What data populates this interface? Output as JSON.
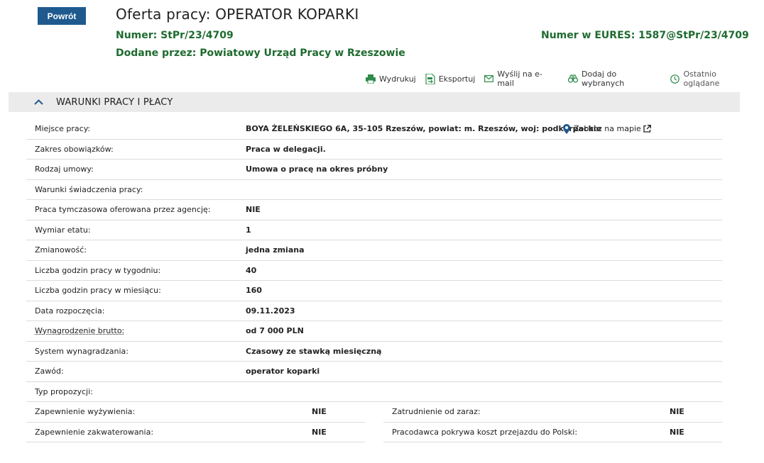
{
  "header": {
    "back_label": "Powrót",
    "title": "Oferta pracy: OPERATOR KOPARKI",
    "numer_label": "Numer: StPr/23/4709",
    "eures_label": "Numer w EURES: 1587@StPr/23/4709",
    "dodane_label": "Dodane przez: ",
    "dodane_value": "Powiatowy Urząd Pracy w Rzeszowie"
  },
  "actions": [
    {
      "label": "Wydrukuj",
      "icon": "printer-icon"
    },
    {
      "label": "Eksportuj",
      "icon": "export-file-icon"
    },
    {
      "label": "Wyślij na e-mail",
      "icon": "envelope-icon"
    },
    {
      "label": "Dodaj do wybranych",
      "icon": "binoculars-icon"
    },
    {
      "label": "Ostatnio oglądane",
      "icon": "clock-icon"
    }
  ],
  "section": {
    "title": "WARUNKI PRACY I PŁACY",
    "chevron_icon": "chevron-up-icon"
  },
  "rows": [
    {
      "key": "Miejsce pracy:",
      "value": "BOYA ŻELEŃSKIEGO 6A, 35-105 Rzeszów, powiat: m. Rzeszów, woj: podkarpackie"
    },
    {
      "key": "Zakres obowiązków:",
      "value": "Praca w delegacji."
    },
    {
      "key": "Rodzaj umowy:",
      "value": "Umowa o pracę na okres próbny"
    },
    {
      "key": "Warunki świadczenia pracy:",
      "value": ""
    },
    {
      "key": "Praca tymczasowa oferowana przez agencję:",
      "value": "NIE"
    },
    {
      "key": "Wymiar etatu:",
      "value": "1"
    },
    {
      "key": "Zmianowość:",
      "value": "jedna zmiana"
    },
    {
      "key": "Liczba godzin pracy w tygodniu:",
      "value": "40"
    },
    {
      "key": "Liczba godzin pracy w miesiącu:",
      "value": "160"
    },
    {
      "key": "Data rozpoczęcia:",
      "value": "09.11.2023"
    },
    {
      "key": "Wynagrodzenie brutto:",
      "value": "od 7 000 PLN"
    },
    {
      "key": "System wynagradzania:",
      "value": "Czasowy ze stawką miesięczną"
    },
    {
      "key": "Zawód:",
      "value": "operator koparki"
    },
    {
      "key": "Typ propozycji:",
      "value": ""
    }
  ],
  "map_link": "Zobacz na mapie",
  "split_rows": [
    {
      "left_key": "Zapewnienie wyżywienia:",
      "left_value": "NIE",
      "right_key": "Zatrudnienie od zaraz:",
      "right_value": "NIE"
    },
    {
      "left_key": "Zapewnienie zakwaterowania:",
      "left_value": "NIE",
      "right_key": "Pracodawca pokrywa koszt przejazdu do Polski:",
      "right_value": "NIE"
    }
  ],
  "colors": {
    "accent_blue": "#1f5a8e",
    "green_text": "#1e6b2f",
    "section_bg": "#ebebeb"
  }
}
